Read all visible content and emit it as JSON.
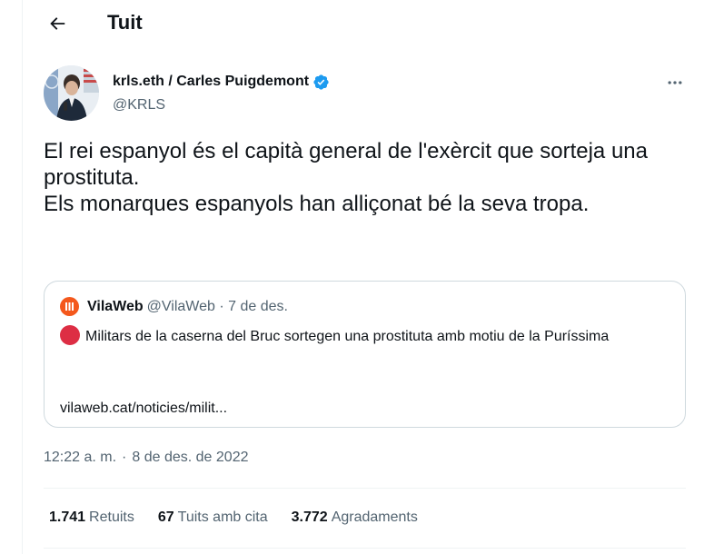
{
  "header": {
    "title": "Tuit"
  },
  "author": {
    "display_name": "krls.eth / Carles Puigdemont",
    "handle": "@KRLS",
    "verified": true
  },
  "tweet": {
    "lines": [
      "El rei espanyol és el capità general de l'exèrcit que sorteja una prostituta.",
      "Els monarques espanyols han alliçonat bé la seva tropa."
    ]
  },
  "quote": {
    "name": "VilaWeb",
    "meta": "@VilaWeb · 7 de des.",
    "text": "Militars de la caserna del Bruc sortegen una prostituta amb motiu de la Puríssima",
    "link": "vilaweb.cat/noticies/milit..."
  },
  "timestamp": {
    "time": "12:22 a. m.",
    "separator": "·",
    "date": "8 de des. de 2022"
  },
  "stats": {
    "retweets_count": "1.741",
    "retweets_label": "Retuits",
    "quotes_count": "67",
    "quotes_label": "Tuits amb cita",
    "likes_count": "3.772",
    "likes_label": "Agradaments"
  },
  "icons": {
    "back": "arrow-left-icon",
    "verified": "verified-badge-icon",
    "more": "more-horizontal-icon",
    "red_circle": "red-circle-emoji"
  },
  "colors": {
    "verified_blue": "#1d9bf0",
    "secondary_text": "#536471",
    "vilaweb_orange": "#f4581c",
    "red_circle": "#dd2e44"
  }
}
